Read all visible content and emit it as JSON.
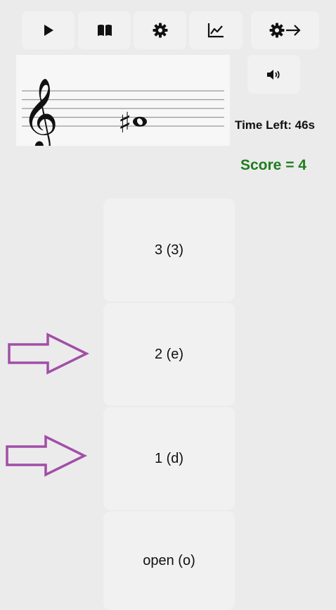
{
  "toolbar": {
    "buttons": [
      {
        "icon": "play-icon"
      },
      {
        "icon": "book-icon"
      },
      {
        "icon": "gear-icon"
      },
      {
        "icon": "chart-icon"
      },
      {
        "icon": "gear-arrow-icon"
      }
    ]
  },
  "staff": {
    "clef": "treble",
    "note": "sharp whole note",
    "glyphs": {
      "clef": "𝄞",
      "sharp": "♯"
    }
  },
  "sound": {
    "icon": "speaker-icon"
  },
  "status": {
    "time_left": "Time Left: 46s",
    "score": "Score = 4",
    "score_color": "#1e7d1e"
  },
  "answers": [
    {
      "label": "3 (3)"
    },
    {
      "label": "2 (e)"
    },
    {
      "label": "1 (d)"
    },
    {
      "label": "open (o)"
    }
  ],
  "arrow_color": "#a24ea8"
}
